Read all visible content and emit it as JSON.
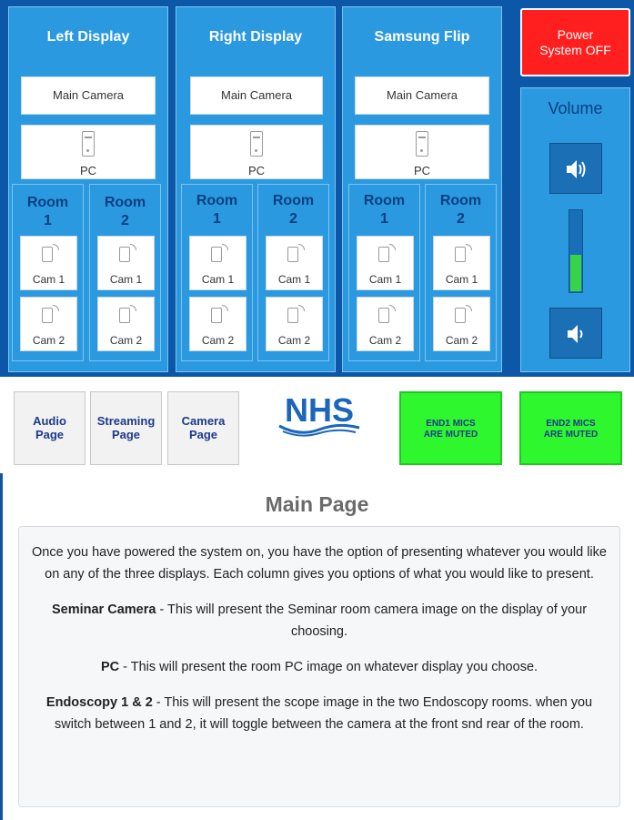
{
  "columns": [
    {
      "title": "Left Display",
      "main_camera": "Main Camera",
      "pc": "PC",
      "rooms": [
        {
          "title_l1": "Room",
          "title_l2": "1",
          "cam1": "Cam 1",
          "cam2": "Cam 2"
        },
        {
          "title_l1": "Room",
          "title_l2": "2",
          "cam1": "Cam 1",
          "cam2": "Cam 2"
        }
      ]
    },
    {
      "title": "Right Display",
      "main_camera": "Main Camera",
      "pc": "PC",
      "rooms": [
        {
          "title_l1": "Room",
          "title_l2": "1",
          "cam1": "Cam 1",
          "cam2": "Cam 2"
        },
        {
          "title_l1": "Room",
          "title_l2": "2",
          "cam1": "Cam 1",
          "cam2": "Cam 2"
        }
      ]
    },
    {
      "title": "Samsung Flip",
      "main_camera": "Main Camera",
      "pc": "PC",
      "rooms": [
        {
          "title_l1": "Room",
          "title_l2": "1",
          "cam1": "Cam 1",
          "cam2": "Cam 2"
        },
        {
          "title_l1": "Room",
          "title_l2": "2",
          "cam1": "Cam 1",
          "cam2": "Cam 2"
        }
      ]
    }
  ],
  "power": {
    "line1": "Power",
    "line2": "System OFF",
    "color": "#ff1f1f"
  },
  "volume": {
    "title": "Volume",
    "level_fraction": 0.45,
    "fill_color": "#39d349"
  },
  "nav": [
    {
      "label": "Audio Page"
    },
    {
      "label": "Streaming Page"
    },
    {
      "label": "Camera Page"
    }
  ],
  "logo": {
    "text": "NHS",
    "color": "#1b66b8"
  },
  "mute": [
    {
      "line1": "END1 MICS",
      "line2": "ARE MUTED"
    },
    {
      "line1": "END2 MICS",
      "line2": "ARE MUTED"
    }
  ],
  "mute_color": "#2ef72e",
  "info": {
    "title": "Main Page",
    "intro": "Once you have powered the system on, you have the option of presenting whatever you would like on any of the three displays. Each column gives you options of what you would like to present.",
    "items": [
      {
        "term": "Seminar Camera",
        "desc": " - This will present the Seminar room camera image on the display of your choosing."
      },
      {
        "term": "PC",
        "desc": " - This will present the room PC image on whatever display you choose."
      },
      {
        "term": "Endoscopy 1 & 2",
        "desc": " - This will present the scope image in the two Endoscopy rooms. when you switch between 1 and 2, it will toggle between the camera at the front snd rear of the room."
      }
    ]
  }
}
